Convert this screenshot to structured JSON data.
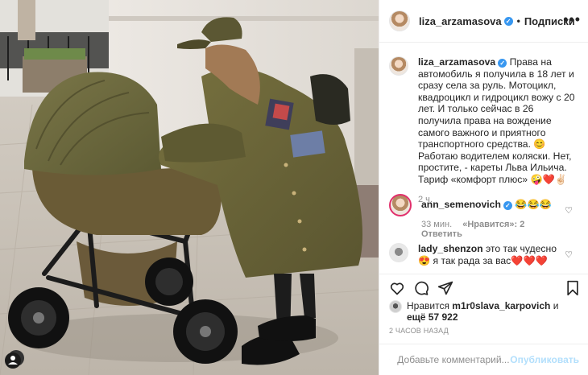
{
  "header": {
    "username": "liza_arzamasova",
    "separator": "•",
    "follow_label": "Подписки",
    "more_label": "•••"
  },
  "caption": {
    "username": "liza_arzamasova",
    "text": "Права на автомобиль я получила в 18 лет и сразу села за руль. Мотоцикл, квадроцикл и гидроцикл вожу с 20 лет. И только сейчас в 26 получила права на вождение самого важного и приятного транспортного средства. 😊 Работаю водителем коляски. Нет, простите, - кареты Льва Ильича. Тариф «комфорт плюс» 🤪❤️✌🏻",
    "time": "2 ч."
  },
  "comments": [
    {
      "username": "ann_semenovich",
      "verified": true,
      "text": "😂😂😂",
      "time": "33 мин.",
      "likes": "«Нравится»: 2",
      "reply": "Ответить"
    },
    {
      "username": "lady_shenzon",
      "verified": false,
      "text": "это так чудесно😍 я так рада за вас❤️❤️❤️",
      "time": "",
      "likes": "",
      "reply": ""
    }
  ],
  "likes": {
    "prefix": "Нравится",
    "user": "m1r0slava_karpovich",
    "middle": "и",
    "more": "ещё 57 922"
  },
  "timestamp": "2 ЧАСОВ НАЗАД",
  "composer": {
    "placeholder": "Добавьте комментарий...",
    "publish_label": "Опубликовать"
  },
  "icons": {
    "like": "heart-icon",
    "comment": "comment-icon",
    "share": "share-icon",
    "save": "bookmark-icon",
    "emoji": "emoji-icon"
  },
  "colors": {
    "link_blue": "#3897f0",
    "publish_disabled": "#b2dffc",
    "muted": "#8e8e8e",
    "coat_olive": "#6f6a3a"
  }
}
